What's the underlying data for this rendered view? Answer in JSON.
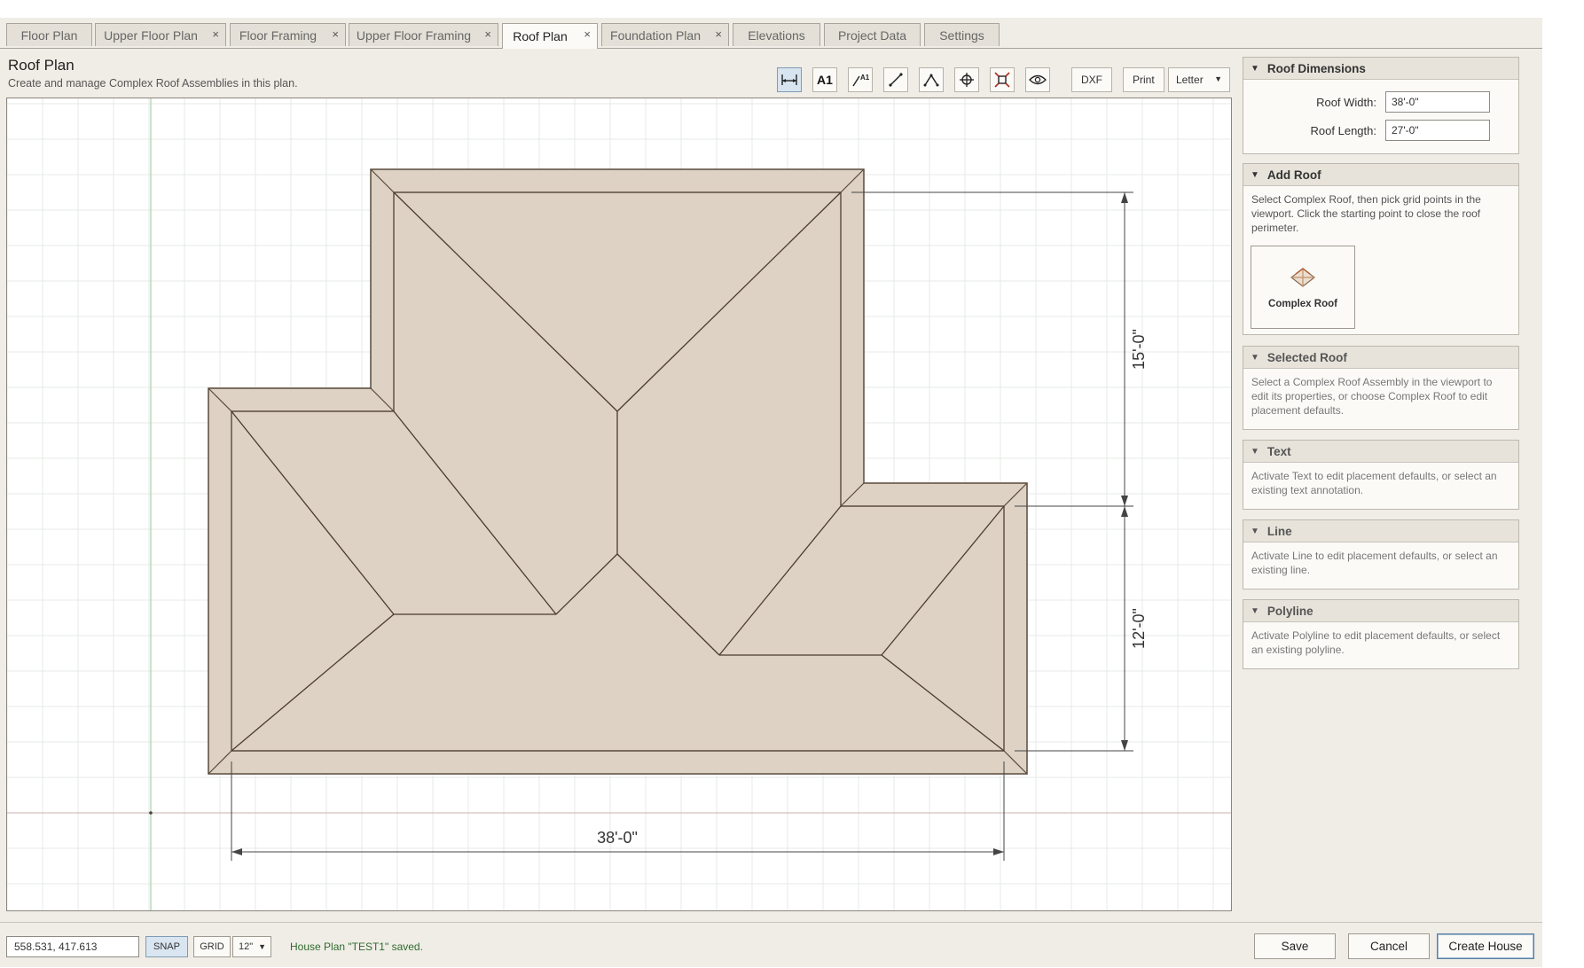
{
  "tabs": [
    {
      "label": "Floor Plan",
      "closable": false,
      "active": false
    },
    {
      "label": "Upper Floor Plan",
      "closable": true,
      "active": false
    },
    {
      "label": "Floor Framing",
      "closable": true,
      "active": false
    },
    {
      "label": "Upper Floor Framing",
      "closable": true,
      "active": false
    },
    {
      "label": "Roof Plan",
      "closable": true,
      "active": true
    },
    {
      "label": "Foundation Plan",
      "closable": true,
      "active": false
    },
    {
      "label": "Elevations",
      "closable": false,
      "active": false
    },
    {
      "label": "Project Data",
      "closable": false,
      "active": false
    },
    {
      "label": "Settings",
      "closable": false,
      "active": false
    }
  ],
  "tab_close_glyph": "×",
  "header": {
    "title": "Roof Plan",
    "subtitle": "Create and manage Complex Roof Assemblies in this plan."
  },
  "toolbar": {
    "dimension_tool_icon": "dimension-tool-icon",
    "text_tool_label": "A1",
    "leader_tool_label": "A1",
    "line_tool_icon": "line-icon",
    "polyline_tool_icon": "polyline-icon",
    "move_tool_icon": "move-icon",
    "zoom_extents_icon": "zoom-extents-icon",
    "visibility_icon": "eye-icon",
    "dxf_label": "DXF",
    "print_label": "Print",
    "paper_size": "Letter"
  },
  "viewport": {
    "dimension_width": "38'-0\"",
    "dimension_upper": "15'-0\"",
    "dimension_lower": "12'-0\""
  },
  "panel": {
    "roof_dimensions": {
      "title": "Roof Dimensions",
      "width_label": "Roof Width:",
      "width_value": "38'-0\"",
      "length_label": "Roof Length:",
      "length_value": "27'-0\""
    },
    "add_roof": {
      "title": "Add Roof",
      "description": "Select Complex Roof, then pick grid points in the viewport. Click the starting point to close the roof perimeter.",
      "button_label": "Complex Roof"
    },
    "selected_roof": {
      "title": "Selected Roof",
      "description": "Select a Complex Roof Assembly in the viewport to edit its properties, or choose Complex Roof to edit placement defaults."
    },
    "text": {
      "title": "Text",
      "description": "Activate Text to edit placement defaults, or select an existing text annotation."
    },
    "line": {
      "title": "Line",
      "description": "Activate Line to edit placement defaults, or select an existing line."
    },
    "polyline": {
      "title": "Polyline",
      "description": "Activate Polyline to edit placement defaults, or select an existing polyline."
    },
    "collapse_glyph": "▼"
  },
  "bottom": {
    "coordinates": "558.531, 417.613",
    "snap_label": "SNAP",
    "grid_label": "GRID",
    "grid_size": "12\"",
    "status": "House Plan \"TEST1\" saved.",
    "save_label": "Save",
    "cancel_label": "Cancel",
    "create_label": "Create House"
  },
  "colors": {
    "roof_fill": "#ddd2c3",
    "roof_stroke": "#5a4a3c",
    "grid": "#e6ebe6",
    "axis_x": "#c9b3ac",
    "axis_y": "#9dc69d",
    "accent": "#5a7fa3"
  }
}
